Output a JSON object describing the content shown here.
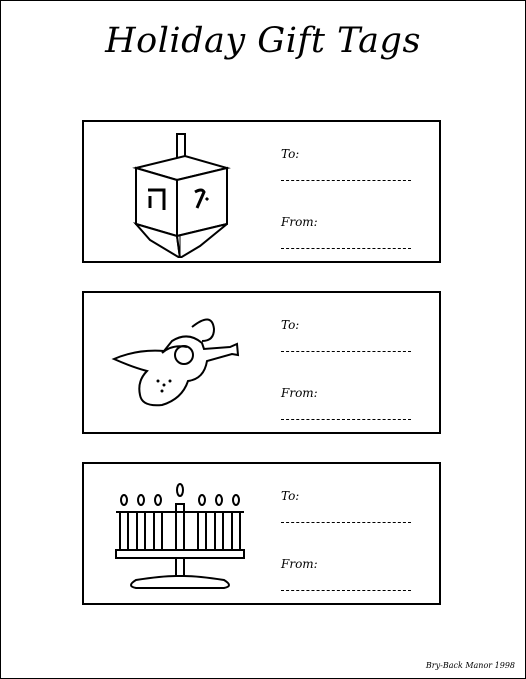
{
  "title": "Holiday Gift Tags",
  "tags": [
    {
      "art": "dreidel-image",
      "to_label": "To:",
      "from_label": "From:"
    },
    {
      "art": "angel-image",
      "to_label": "To:",
      "from_label": "From:"
    },
    {
      "art": "menorah-image",
      "to_label": "To:",
      "from_label": "From:"
    }
  ],
  "credit": "Bry-Back Manor 1998"
}
